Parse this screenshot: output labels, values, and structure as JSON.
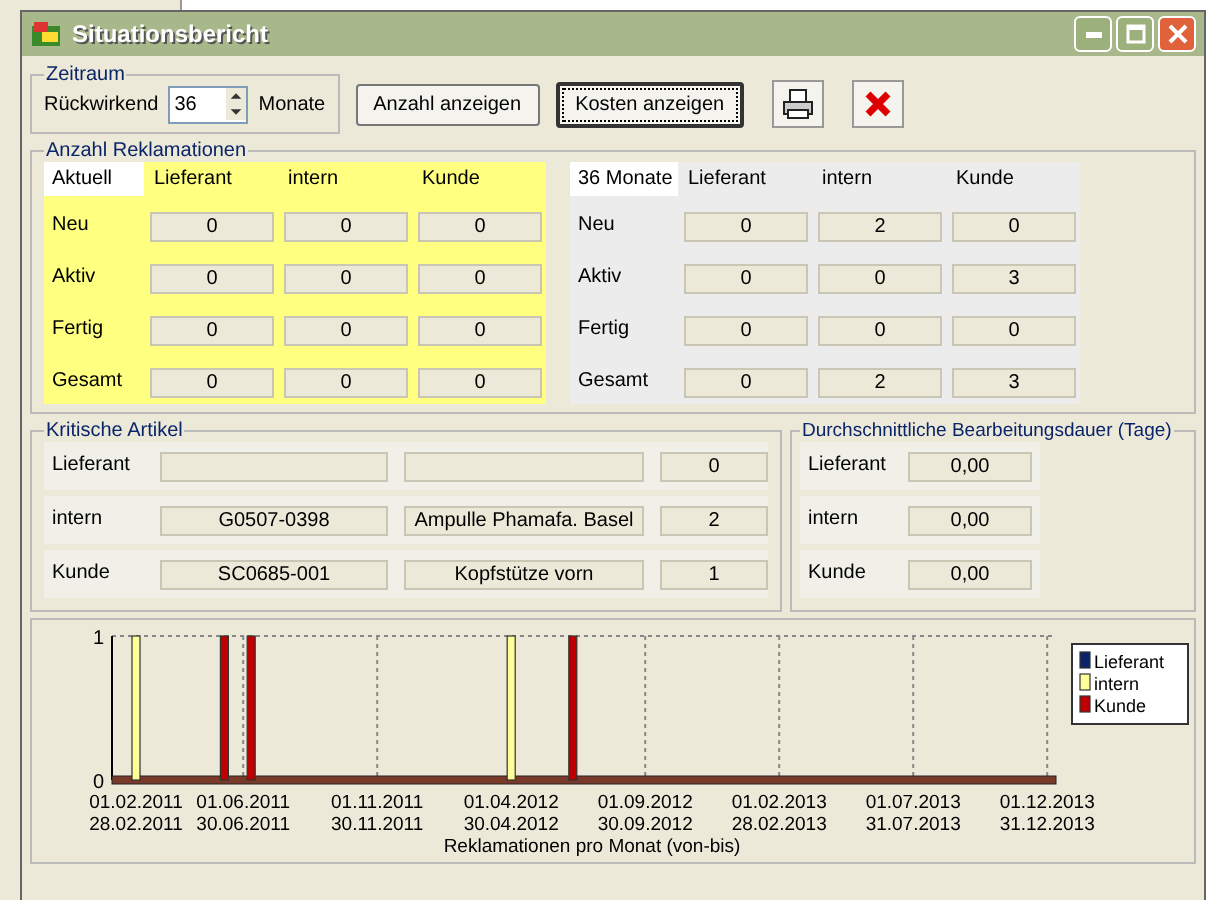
{
  "window": {
    "title": "Situationsbericht"
  },
  "zeitraum": {
    "title": "Zeitraum",
    "label": "Rückwirkend",
    "value": "36",
    "unit": "Monate"
  },
  "buttons": [
    {
      "label": "Anzahl anzeigen",
      "focused": false
    },
    {
      "label": "Kosten anzeigen",
      "focused": true
    }
  ],
  "reklamationen": {
    "title": "Anzahl Reklamationen",
    "tables": [
      {
        "kind": "current",
        "header": "Aktuell",
        "columns": [
          "Lieferant",
          "intern",
          "Kunde"
        ],
        "rows": [
          {
            "label": "Neu",
            "values": [
              "0",
              "0",
              "0"
            ]
          },
          {
            "label": "Aktiv",
            "values": [
              "0",
              "0",
              "0"
            ]
          },
          {
            "label": "Fertig",
            "values": [
              "0",
              "0",
              "0"
            ]
          },
          {
            "label": "Gesamt",
            "values": [
              "0",
              "0",
              "0"
            ]
          }
        ]
      },
      {
        "kind": "period",
        "header": "36 Monate",
        "columns": [
          "Lieferant",
          "intern",
          "Kunde"
        ],
        "rows": [
          {
            "label": "Neu",
            "values": [
              "0",
              "2",
              "0"
            ]
          },
          {
            "label": "Aktiv",
            "values": [
              "0",
              "0",
              "3"
            ]
          },
          {
            "label": "Fertig",
            "values": [
              "0",
              "0",
              "0"
            ]
          },
          {
            "label": "Gesamt",
            "values": [
              "0",
              "2",
              "3"
            ]
          }
        ]
      }
    ]
  },
  "kritische_artikel": {
    "title": "Kritische Artikel",
    "rows": [
      {
        "label": "Lieferant",
        "article": "",
        "name": "",
        "count": "0"
      },
      {
        "label": "intern",
        "article": "G0507-0398",
        "name": "Ampulle Phamafa. Basel",
        "count": "2"
      },
      {
        "label": "Kunde",
        "article": "SC0685-001",
        "name": "Kopfstütze vorn",
        "count": "1"
      }
    ]
  },
  "bearbeitungsdauer": {
    "title": "Durchschnittliche Bearbeitungsdauer (Tage)",
    "rows": [
      {
        "label": "Lieferant",
        "value": "0,00"
      },
      {
        "label": "intern",
        "value": "0,00"
      },
      {
        "label": "Kunde",
        "value": "0,00"
      }
    ]
  },
  "chart": {
    "chart_data": {
      "type": "bar",
      "xlabel": "Reklamationen pro Monat (von-bis)",
      "legend": "right",
      "categories": [
        "01.02.2011 28.02.2011",
        null,
        null,
        null,
        "01.06.2011 30.06.2011",
        null,
        null,
        null,
        null,
        "01.11.2011 30.11.2011",
        null,
        null,
        null,
        null,
        "01.04.2012 30.04.2012",
        null,
        null,
        null,
        null,
        "01.09.2012 30.09.2012",
        null,
        null,
        null,
        null,
        "01.02.2013 28.02.2013",
        null,
        null,
        null,
        null,
        "01.07.2013 31.07.2013",
        null,
        null,
        null,
        null,
        "01.12.2013 31.12.2013"
      ],
      "series": [
        {
          "name": "Lieferant",
          "color": "#0a246a",
          "values": [
            0,
            0,
            0,
            0,
            0,
            0,
            0,
            0,
            0,
            0,
            0,
            0,
            0,
            0,
            0,
            0,
            0,
            0,
            0,
            0,
            0,
            0,
            0,
            0,
            0,
            0,
            0,
            0,
            0,
            0,
            0,
            0,
            0,
            0,
            0
          ]
        },
        {
          "name": "intern",
          "color": "#ffff99",
          "values": [
            1,
            0,
            0,
            0,
            0,
            0,
            0,
            0,
            0,
            0,
            0,
            0,
            0,
            0,
            1,
            0,
            0,
            0,
            0,
            0,
            0,
            0,
            0,
            0,
            0,
            0,
            0,
            0,
            0,
            0,
            0,
            0,
            0,
            0,
            0
          ]
        },
        {
          "name": "Kunde",
          "color": "#c00000",
          "values": [
            0,
            0,
            0,
            1,
            1,
            0,
            0,
            0,
            0,
            0,
            0,
            0,
            0,
            0,
            0,
            0,
            1,
            0,
            0,
            0,
            0,
            0,
            0,
            0,
            0,
            0,
            0,
            0,
            0,
            0,
            0,
            0,
            0,
            0,
            0
          ]
        }
      ],
      "ylim": [
        0,
        1
      ],
      "yticks": [
        0,
        1
      ],
      "grid": true
    }
  }
}
